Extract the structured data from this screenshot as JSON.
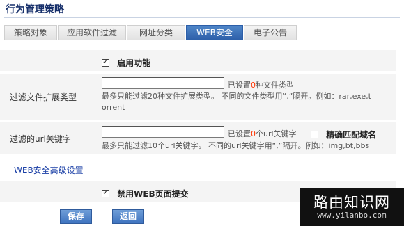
{
  "page": {
    "title": "行为管理策略"
  },
  "tabs": [
    {
      "label": "策略对象"
    },
    {
      "label": "应用软件过滤"
    },
    {
      "label": "网址分类"
    },
    {
      "label": "WEB安全"
    },
    {
      "label": "电子公告"
    }
  ],
  "enable": {
    "label": "启用功能",
    "checked": true
  },
  "ext_filter": {
    "label": "过滤文件扩展类型",
    "value": "",
    "status_prefix": "已设置",
    "count": "0",
    "status_suffix": "种文件类型",
    "hint_line1": "最多只能过滤20种文件扩展类型。 不同的文件类型用“,”隔开。例如：rar,exe,t",
    "hint_line2": "orrent"
  },
  "url_filter": {
    "label": "过滤的url关键字",
    "value": "",
    "status_prefix": "已设置",
    "count": "0",
    "status_suffix": "个url关键字",
    "exact_label": "精确匹配域名",
    "exact_checked": false,
    "hint": "最多只能过滤10个url关键字。 不同的url关键字用“,”隔开。例如：img,bt,bbs"
  },
  "advanced_link": "WEB安全高级设置",
  "disable_submit": {
    "label": "禁用WEB页面提交",
    "checked": true
  },
  "buttons": {
    "save": "保存",
    "back": "返回"
  },
  "watermark": {
    "main": "路由知识网",
    "sub": "www.yilanbo.com"
  }
}
